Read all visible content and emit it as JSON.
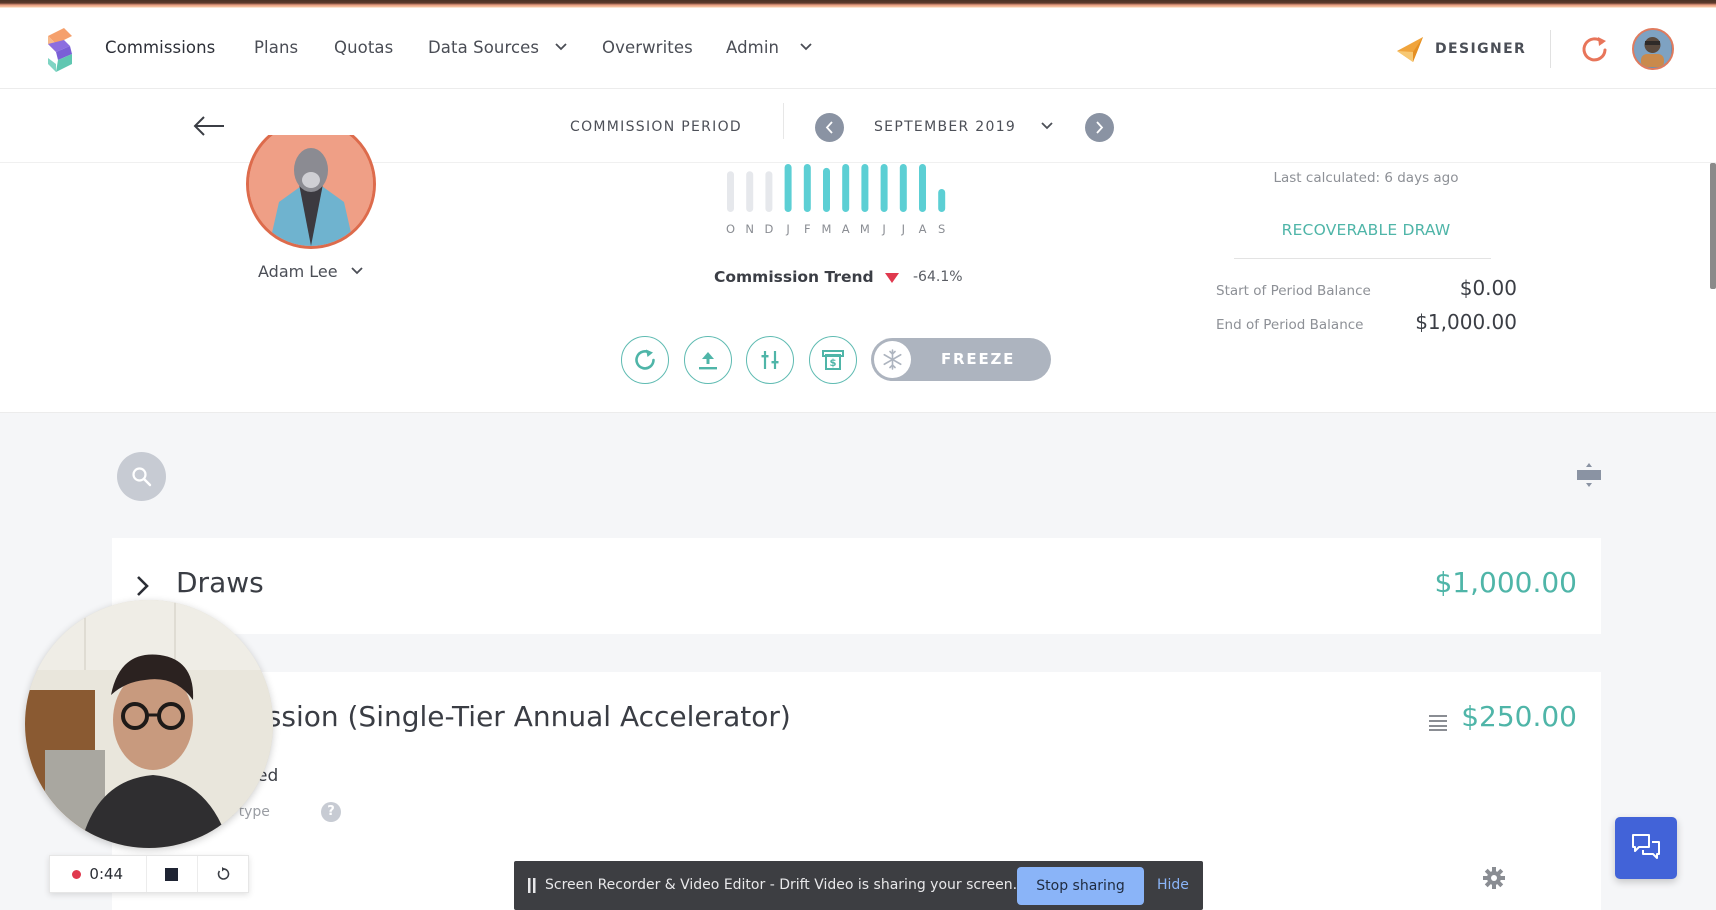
{
  "nav": {
    "items": [
      {
        "label": "Commissions",
        "active": true
      },
      {
        "label": "Plans"
      },
      {
        "label": "Quotas"
      },
      {
        "label": "Data Sources",
        "dropdown": true
      },
      {
        "label": "Overwrites"
      },
      {
        "label": "Admin",
        "dropdown": true
      }
    ],
    "designer_label": "DESIGNER",
    "icons": {
      "logo": "spiff-logo",
      "designer": "paper-plane-icon",
      "refresh": "refresh-icon",
      "avatar": "user-avatar"
    }
  },
  "period": {
    "label": "COMMISSION PERIOD",
    "value": "SEPTEMBER 2019"
  },
  "rep": {
    "name": "Adam Lee"
  },
  "trend": {
    "months": [
      "O",
      "N",
      "D",
      "J",
      "F",
      "M",
      "A",
      "M",
      "J",
      "J",
      "A",
      "S"
    ],
    "bar_levels": [
      0.85,
      0.85,
      0.85,
      1.0,
      1.0,
      0.92,
      1.0,
      1.0,
      1.0,
      1.0,
      1.0,
      0.48
    ],
    "bar_active": [
      false,
      false,
      false,
      true,
      true,
      true,
      true,
      true,
      true,
      true,
      true,
      true
    ],
    "label": "Commission Trend",
    "direction": "down",
    "value": "-64.1%",
    "colors": {
      "active": "#5ccfd4",
      "inactive": "#e6e8ec",
      "down": "#e0394e"
    }
  },
  "actions": {
    "buttons": [
      "recalculate-icon",
      "upload-icon",
      "adjust-sliders-icon",
      "payout-icon"
    ],
    "freeze_label": "FREEZE"
  },
  "draw_summary": {
    "last_calculated": "Last calculated: 6 days ago",
    "title": "RECOVERABLE DRAW",
    "rows": [
      {
        "label": "Start of Period Balance",
        "value": "$0.00"
      },
      {
        "label": "End of Period Balance",
        "value": "$1,000.00"
      }
    ]
  },
  "cards": [
    {
      "title": "Draws",
      "amount": "$1,000.00",
      "expanded": false
    },
    {
      "title": "ission (Single-Tier Annual Accelerator)",
      "amount": "$250.00",
      "status": "ed",
      "rule_type": "rule type"
    }
  ],
  "recorder": {
    "time": "0:44"
  },
  "share_bar": {
    "message": "Screen Recorder & Video Editor - Drift Video is sharing your screen.",
    "stop_label": "Stop sharing",
    "hide_label": "Hide"
  },
  "colors": {
    "accent": "#4fb5a8",
    "chat": "#4263d8",
    "share_button": "#8ab4f8"
  }
}
